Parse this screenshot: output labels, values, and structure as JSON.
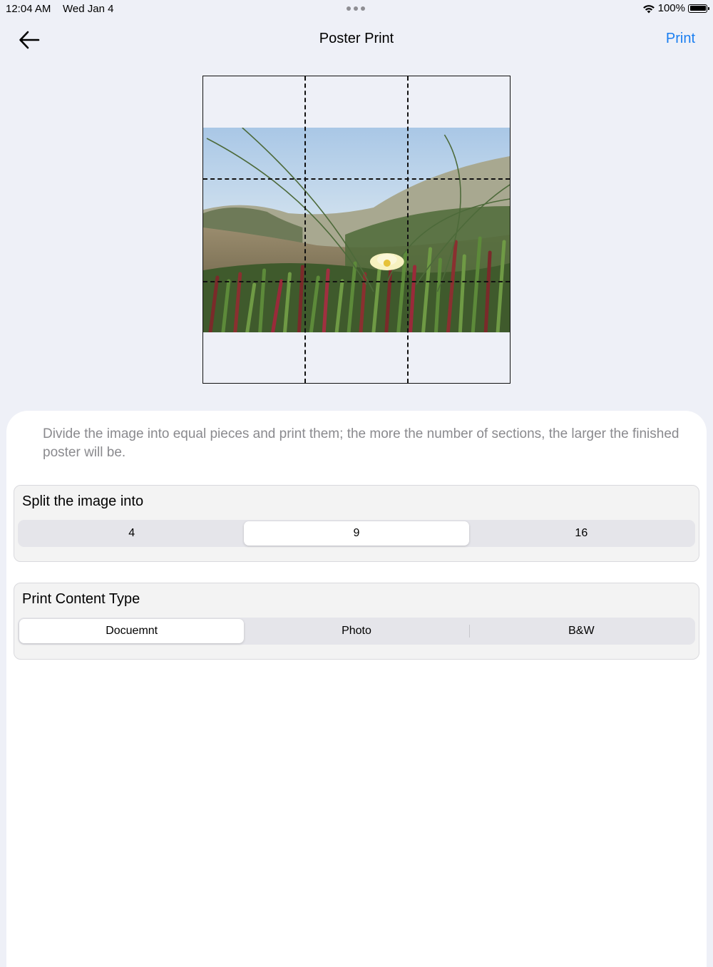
{
  "status_bar": {
    "time": "12:04 AM",
    "date": "Wed Jan 4",
    "battery": "100%"
  },
  "nav": {
    "title": "Poster Print",
    "print_label": "Print",
    "back_icon": "arrow-left-icon"
  },
  "preview": {
    "grid": "3x3"
  },
  "description": "Divide the image into equal pieces and print them; the more the number of sections, the larger the finished poster will be.",
  "split": {
    "title": "Split the image into",
    "options": [
      "4",
      "9",
      "16"
    ],
    "selected": "9"
  },
  "content_type": {
    "title": "Print Content Type",
    "options": [
      "Docuemnt",
      "Photo",
      "B&W"
    ],
    "selected": "Docuemnt"
  },
  "colors": {
    "accent": "#1a7ef0",
    "background": "#eef0f7"
  }
}
